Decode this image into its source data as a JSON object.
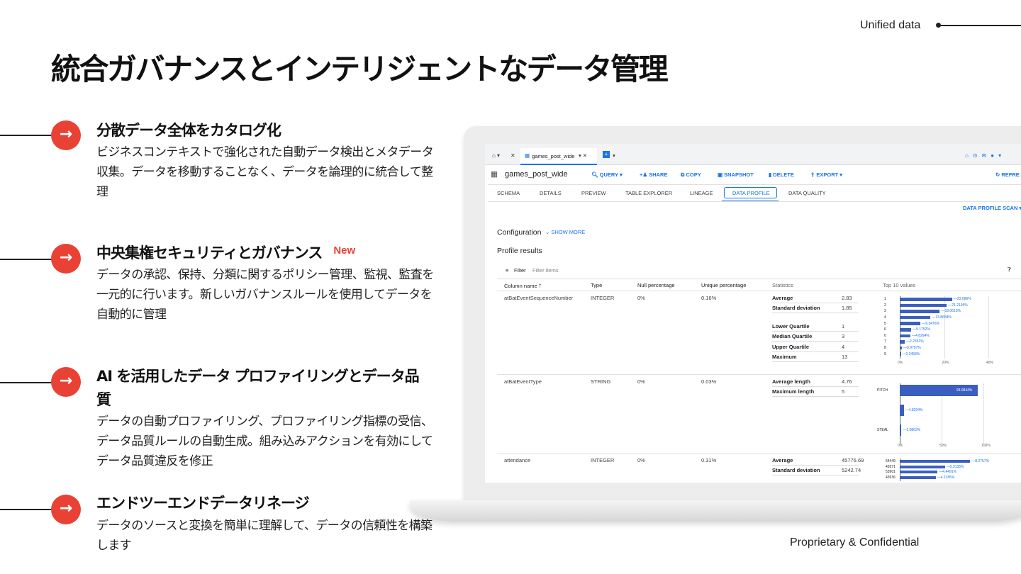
{
  "header": {
    "section_label": "Unified data",
    "title": "統合ガバナンスとインテリジェントなデータ管理"
  },
  "features": [
    {
      "title": "分散データ全体をカタログ化",
      "description": "ビジネスコンテキストで強化された自動データ検出とメタデータ収集。データを移動することなく、データを論理的に統合して整理"
    },
    {
      "title": "中央集権セキュリティとガバナンス",
      "badge": "New",
      "description": "データの承認、保持、分類に関するポリシー管理、監視、監査を一元的に行います。新しいガバナンスルールを使用してデータを自動的に管理"
    },
    {
      "title": "AI を活用したデータ プロファイリングとデータ品質",
      "description": "データの自動プロファイリング、プロファイリング指標の受信、データ品質ルールの自動生成。組み込みアクションを有効にしてデータ品質違反を修正"
    },
    {
      "title": "エンドツーエンドデータリネージ",
      "description": "データのソースと変換を簡単に理解して、データの信頼性を構築します"
    }
  ],
  "footer": "Proprietary & Confidential",
  "app": {
    "tab_label": "games_post_wide",
    "table_name": "games_post_wide",
    "toolbar": [
      "QUERY",
      "SHARE",
      "COPY",
      "SNAPSHOT",
      "DELETE",
      "EXPORT"
    ],
    "refresh_label": "REFRE",
    "subtabs": [
      "SCHEMA",
      "DETAILS",
      "PREVIEW",
      "TABLE EXPLORER",
      "LINEAGE",
      "DATA PROFILE",
      "DATA QUALITY"
    ],
    "scan_button": "DATA PROFILE SCAN",
    "configuration_label": "Configuration",
    "show_more": "SHOW MORE",
    "profile_results": "Profile results",
    "filter_label": "Filter",
    "filter_placeholder": "Filter items",
    "columns": [
      "Column name",
      "Type",
      "Null percentage",
      "Unique percentage",
      "Statistics",
      "Top 10 values"
    ],
    "rows": [
      {
        "name": "atBatEventSequenceNumber",
        "type": "INTEGER",
        "null_pct": "0%",
        "unique_pct": "0.16%",
        "stats": [
          [
            "Average",
            "2.83"
          ],
          [
            "Standard deviation",
            "1.85"
          ],
          [
            "Lower Quartile",
            "1"
          ],
          [
            "Median Quartile",
            "3"
          ],
          [
            "Upper Quartile",
            "4"
          ],
          [
            "Maximum",
            "13"
          ]
        ],
        "top_labels": [
          "1",
          "2",
          "3",
          "4",
          "5",
          "6",
          "0",
          "7",
          "8",
          "9"
        ],
        "top_values": [
          23.686,
          21.2195,
          18.0613,
          13.8658,
          9.3476,
          5.1752,
          4.8294,
          2.2361,
          0.9797,
          0.3458
        ],
        "top_text": [
          "23.686%",
          "21.2195%",
          "18.0613%",
          "13.8658%",
          "9.3476%",
          "5.1752%",
          "4.8294%",
          "2.2361%",
          "0.9797%",
          "0.3458%"
        ],
        "axis": [
          "0%",
          "20%",
          "40%"
        ]
      },
      {
        "name": "atBatEventType",
        "type": "STRING",
        "null_pct": "0%",
        "unique_pct": "0.03%",
        "stats": [
          [
            "Average length",
            "4.76"
          ],
          [
            "Maximum length",
            "5"
          ]
        ],
        "top_labels": [
          "PITCH",
          "",
          "STEAL"
        ],
        "top_values": [
          93.0844,
          4.8294,
          2.0862
        ],
        "top_text": [
          "93.0844%",
          "4.8294%",
          "2.0862%"
        ],
        "axis": [
          "0%",
          "50%",
          "100%"
        ]
      },
      {
        "name": "attendance",
        "type": "INTEGER",
        "null_pct": "0%",
        "unique_pct": "0.31%",
        "stats": [
          [
            "Average",
            "45776.69"
          ],
          [
            "Standard deviation",
            "5242.74"
          ]
        ],
        "top_labels": [
          "54449",
          "43571",
          "53901",
          "43936"
        ],
        "top_values": [
          8.2757,
          5.3135,
          4.4491,
          4.2185
        ],
        "top_text": [
          "8.2757%",
          "5.3135%",
          "4.4491%",
          "4.2185%"
        ]
      }
    ]
  },
  "colors": {
    "accent_red": "#e94235",
    "bar_blue": "#3b5fc0",
    "link_blue": "#1a73e8"
  },
  "icons": [
    "arrow-right-icon",
    "home-icon",
    "close-icon",
    "table-icon",
    "search-icon",
    "add-person-icon",
    "copy-icon",
    "snapshot-icon",
    "trash-icon",
    "export-icon",
    "refresh-icon",
    "filter-icon",
    "help-icon",
    "sort-arrow-icon"
  ]
}
